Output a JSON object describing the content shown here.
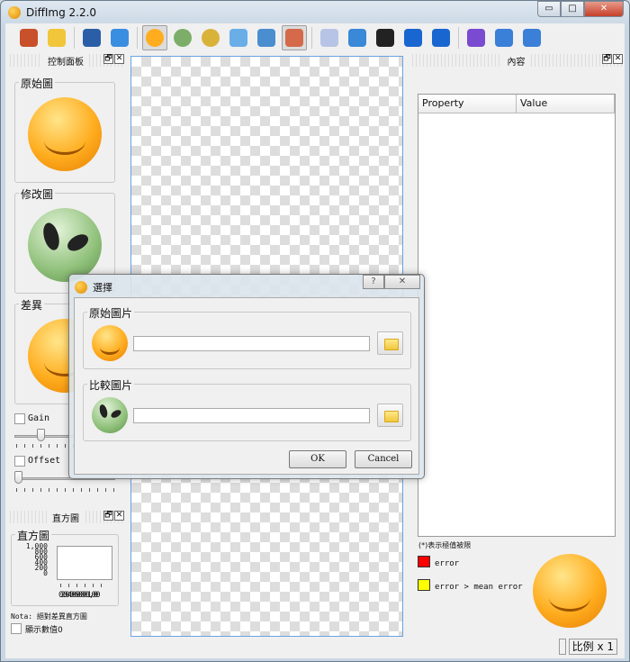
{
  "window": {
    "title": "DiffImg 2.2.0",
    "minimize": "▭",
    "maximize": "□",
    "close": "✕"
  },
  "toolbar": {
    "items": [
      {
        "name": "quit",
        "color": "#c8502a"
      },
      {
        "name": "open-folder",
        "color": "#f1c63a"
      },
      {
        "name": "save",
        "color": "#2a5fa8"
      },
      {
        "name": "refresh",
        "color": "#3a8ee0"
      },
      {
        "name": "original-image",
        "color": "#ffad1f",
        "active": true
      },
      {
        "name": "modified-image",
        "color": "#7cae6a"
      },
      {
        "name": "difference-image",
        "color": "#d9b23a"
      },
      {
        "name": "dual-panel",
        "color": "#6aaee8"
      },
      {
        "name": "single-panel",
        "color": "#4a8ed0"
      },
      {
        "name": "mask",
        "color": "#d46a4a",
        "active": true
      },
      {
        "name": "synchronize",
        "color": "#b8c4e6"
      },
      {
        "name": "zoom-fit",
        "color": "#3a88d8"
      },
      {
        "name": "zoom-1-1",
        "color": "#222"
      },
      {
        "name": "previous",
        "color": "#1a66d0"
      },
      {
        "name": "next",
        "color": "#1a66d0"
      },
      {
        "name": "preferences",
        "color": "#7a4ad0"
      },
      {
        "name": "info",
        "color": "#3a7fd8"
      },
      {
        "name": "help",
        "color": "#3a7fd8"
      }
    ]
  },
  "left_dock": {
    "title": "控制面板",
    "float": "🗗",
    "close": "✕",
    "original_label": "原始圖",
    "modified_label": "修改圖",
    "diff_label": "差異",
    "gain_label": "Gain",
    "gain_value": 0.3,
    "offset_label": "Offset",
    "offset_value": 0.0
  },
  "histogram_dock": {
    "title": "直方圖",
    "group_label": "直方圖",
    "y_ticks": [
      "1,000",
      "800",
      "600",
      "400",
      "200",
      "0"
    ],
    "x_ticks": [
      "0",
      "200",
      "400",
      "600",
      "800",
      "1,000"
    ],
    "note": "Nota: 絕對差異直方圖",
    "show_zero_label": "顯示數值0"
  },
  "right_dock": {
    "title": "內容",
    "columns": [
      "Property",
      "Value"
    ],
    "rows": [],
    "legend_note": "(*)表示極值被限",
    "legend": [
      {
        "label": "error",
        "color": "#ff0000"
      },
      {
        "label": "error > mean error",
        "color": "#ffff00"
      }
    ]
  },
  "status": {
    "scale": "比例 x 1"
  },
  "dialog": {
    "title": "選擇",
    "help": "?",
    "close": "✕",
    "original_group": "原始圖片",
    "original_path": "",
    "compare_group": "比較圖片",
    "compare_path": "",
    "ok": "OK",
    "cancel": "Cancel"
  }
}
